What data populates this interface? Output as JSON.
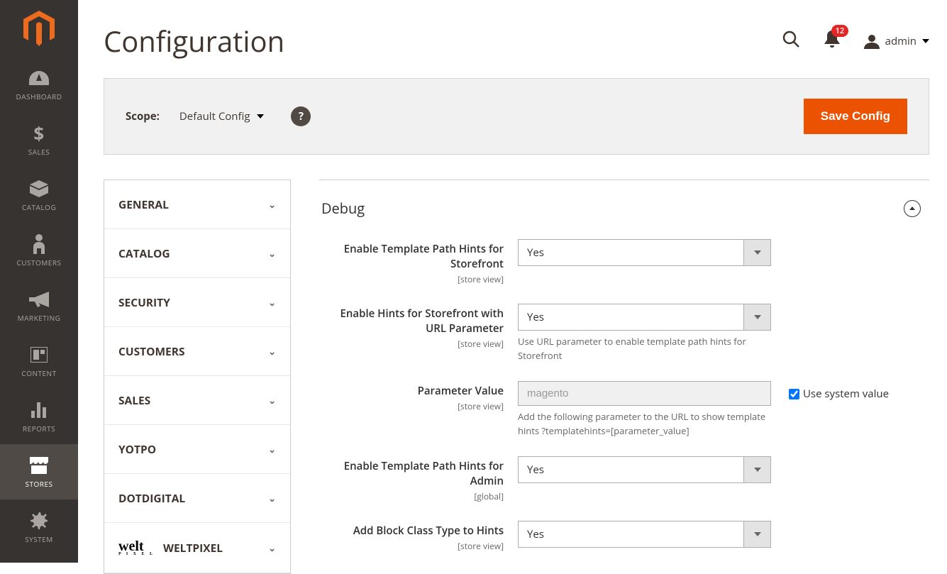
{
  "sidebar": {
    "items": [
      {
        "label": "DASHBOARD"
      },
      {
        "label": "SALES"
      },
      {
        "label": "CATALOG"
      },
      {
        "label": "CUSTOMERS"
      },
      {
        "label": "MARKETING"
      },
      {
        "label": "CONTENT"
      },
      {
        "label": "REPORTS"
      },
      {
        "label": "STORES"
      },
      {
        "label": "SYSTEM"
      }
    ]
  },
  "header": {
    "title": "Configuration",
    "username": "admin",
    "notifications": "12"
  },
  "scope": {
    "label": "Scope:",
    "value": "Default Config",
    "save_label": "Save Config"
  },
  "config_nav": [
    {
      "label": "GENERAL"
    },
    {
      "label": "CATALOG"
    },
    {
      "label": "SECURITY"
    },
    {
      "label": "CUSTOMERS"
    },
    {
      "label": "SALES"
    },
    {
      "label": "YOTPO"
    },
    {
      "label": "DOTDIGITAL"
    },
    {
      "label": "WELTPIXEL"
    }
  ],
  "section": {
    "title": "Debug",
    "fields": [
      {
        "label": "Enable Template Path Hints for Storefront",
        "scope": "[store view]",
        "value": "Yes"
      },
      {
        "label": "Enable Hints for Storefront with URL Parameter",
        "scope": "[store view]",
        "value": "Yes",
        "hint": "Use URL parameter to enable template path hints for Storefront"
      },
      {
        "label": "Parameter Value",
        "scope": "[store view]",
        "value": "magento",
        "hint": "Add the following parameter to the URL to show template hints ?templatehints=[parameter_value]",
        "use_system": "Use system value"
      },
      {
        "label": "Enable Template Path Hints for Admin",
        "scope": "[global]",
        "value": "Yes"
      },
      {
        "label": "Add Block Class Type to Hints",
        "scope": "[store view]",
        "value": "Yes"
      }
    ]
  }
}
